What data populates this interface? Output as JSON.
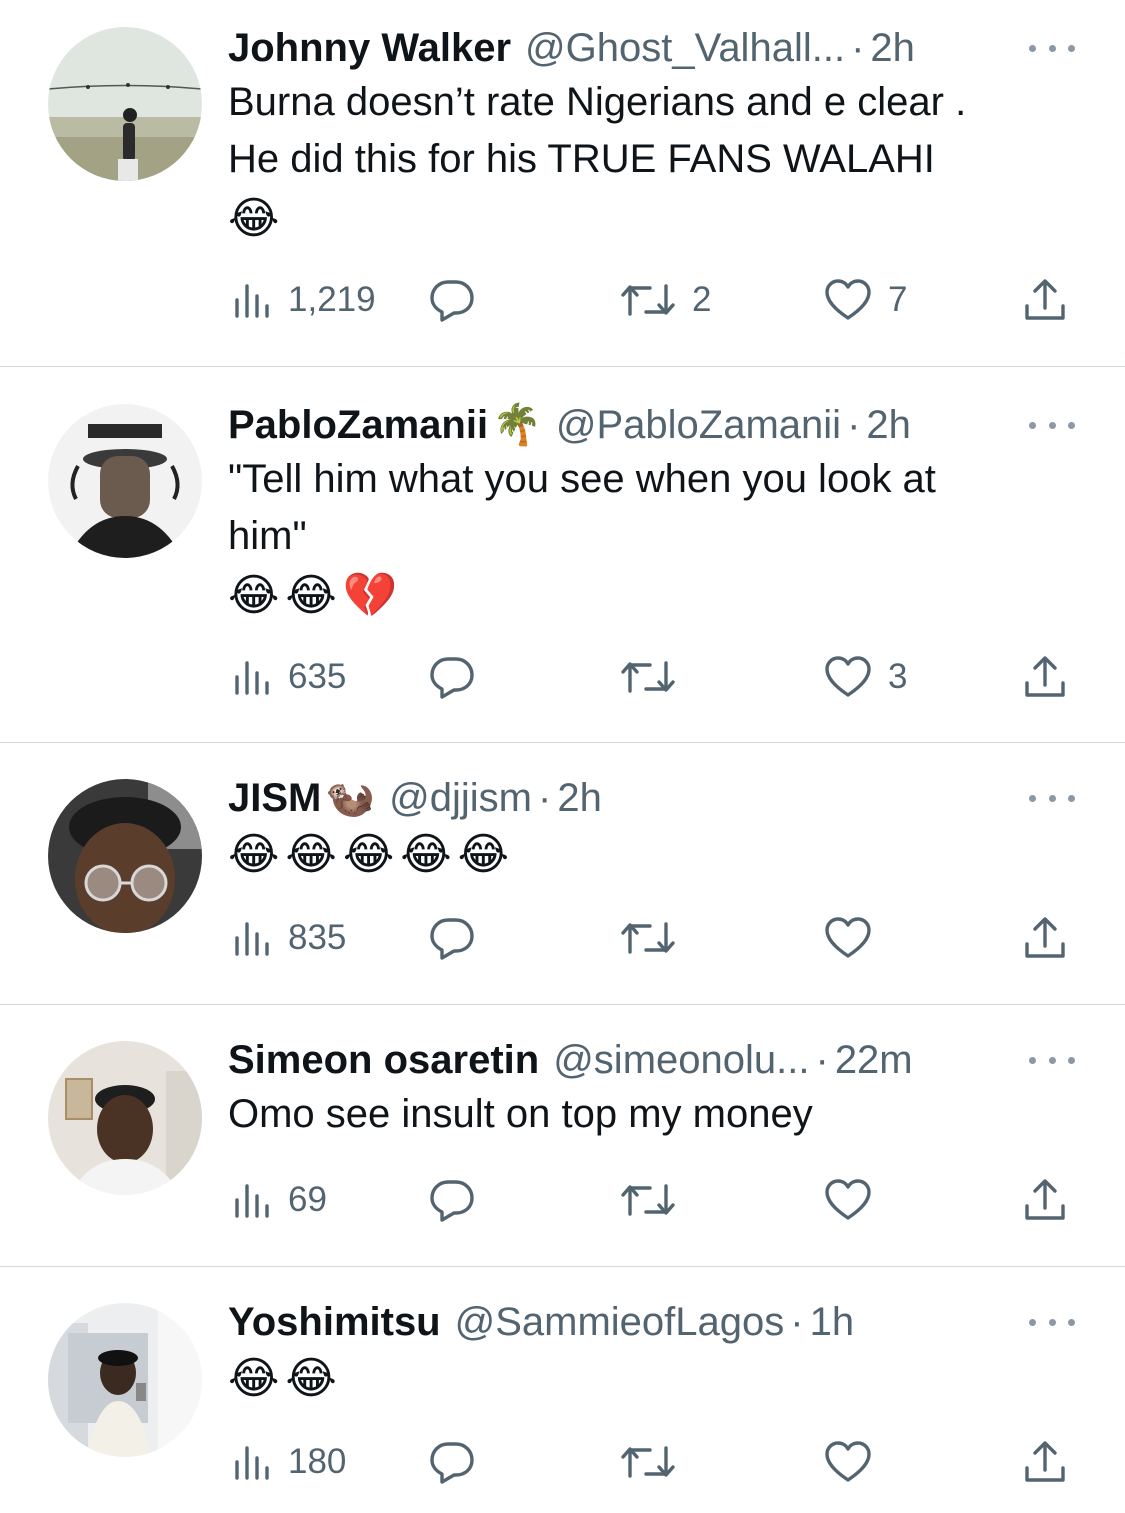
{
  "tweets": [
    {
      "name": "Johnny Walker",
      "badge": "",
      "handle": "@Ghost_Valhall...",
      "time": "2h",
      "text_lines": [
        "Burna doesn’t rate Nigerians and e clear .",
        "He did this for his TRUE FANS WALAHI"
      ],
      "emoji": "😂",
      "views": "1,219",
      "replies": "",
      "retweets": "2",
      "likes": "7"
    },
    {
      "name": "PabloZamanii",
      "badge": "🌴",
      "handle": "@PabloZamanii",
      "time": "2h",
      "text_lines": [
        "\"Tell him what you see when you look at",
        "him\""
      ],
      "emoji": "😂😂💔",
      "views": "635",
      "replies": "",
      "retweets": "",
      "likes": "3"
    },
    {
      "name": "JISM",
      "badge": "🦦",
      "handle": "@djjism",
      "time": "2h",
      "text_lines": [],
      "emoji": "😂😂😂😂😂",
      "views": "835",
      "replies": "",
      "retweets": "",
      "likes": ""
    },
    {
      "name": "Simeon osaretin",
      "badge": "",
      "handle": "@simeonolu...",
      "time": "22m",
      "text_lines": [
        "Omo see insult on top my money"
      ],
      "emoji": "",
      "views": "69",
      "replies": "",
      "retweets": "",
      "likes": ""
    },
    {
      "name": "Yoshimitsu",
      "badge": "",
      "handle": "@SammieofLagos",
      "time": "1h",
      "text_lines": [],
      "emoji": "😂😂",
      "views": "180",
      "replies": "",
      "retweets": "",
      "likes": ""
    }
  ],
  "separator": "·",
  "icons": {
    "views": "views-bar-chart-icon",
    "reply": "reply-bubble-icon",
    "retweet": "retweet-icon",
    "like": "heart-icon",
    "share": "share-upload-icon",
    "more": "more-dots-icon"
  },
  "colors": {
    "text": "#0f1419",
    "secondary": "#536471",
    "divider": "#cfd9de"
  }
}
